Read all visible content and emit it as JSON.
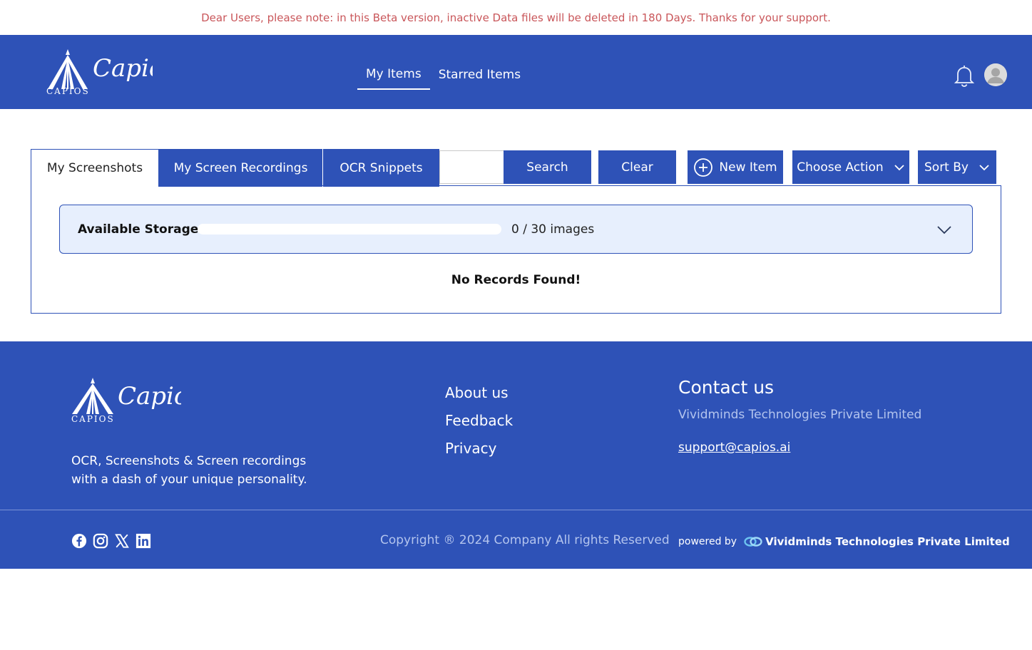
{
  "banner": {
    "text": "Dear Users, please note: in this Beta version, inactive Data files will be deleted in 180 Days. Thanks for your support.",
    "color": "#c9565a"
  },
  "theme": {
    "primary": "#2e52b7",
    "storage_bg": "#e7effd"
  },
  "header": {
    "logo_text": "CAPIOS",
    "logo_script": "Capios",
    "nav": [
      {
        "label": "My Items",
        "active": true
      },
      {
        "label": "Starred Items",
        "active": false
      }
    ],
    "icons": {
      "notifications": "bell-icon",
      "profile": "avatar"
    }
  },
  "tabs": [
    {
      "label": "My Screenshots",
      "active": true
    },
    {
      "label": "My Screen Recordings",
      "active": false
    },
    {
      "label": "OCR Snippets",
      "active": false
    }
  ],
  "toolbar": {
    "search_value": "",
    "search_label": "Search",
    "clear_label": "Clear",
    "new_item_label": "New Item",
    "choose_action_label": "Choose Action",
    "sort_by_label": "Sort By"
  },
  "storage": {
    "label": "Available Storage",
    "used": 0,
    "total": 30,
    "count_text": "0 / 30 images",
    "fill_fraction": 0
  },
  "empty_message": "No Records Found!",
  "footer": {
    "logo_text": "CAPIOS",
    "logo_script": "Capios",
    "tagline_line1": "OCR, Screenshots & Screen recordings",
    "tagline_line2": "with a dash of your unique personality.",
    "links": [
      "About us",
      "Feedback",
      "Privacy"
    ],
    "contact_title": "Contact us",
    "contact_company": "Vividminds Technologies Private Limited",
    "contact_email": "support@capios.ai",
    "socials": [
      "facebook-icon",
      "instagram-icon",
      "x-icon",
      "linkedin-icon"
    ],
    "copyright": "Copyright ® 2024 Company All rights Reserved",
    "powered_by_label": "powered by",
    "powered_by_brand": "Vividminds Technologies Private Limited"
  }
}
